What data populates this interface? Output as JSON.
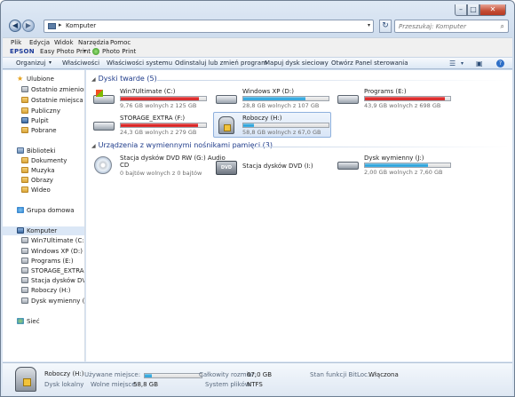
{
  "titlebar": {
    "address_text": "Komputer",
    "search_placeholder": "Przeszukaj: Komputer"
  },
  "menu": [
    "Plik",
    "Edycja",
    "Widok",
    "Narzędzia",
    "Pomoc"
  ],
  "epson_bar": {
    "logo": "EPSON",
    "easy_photo_print": "Easy Photo Print",
    "photo_print": "Photo Print"
  },
  "toolbar": {
    "organize": "Organizuj",
    "properties": "Właściwości",
    "system_properties": "Właściwości systemu",
    "uninstall": "Odinstaluj lub zmień program",
    "map_drive": "Mapuj dysk sieciowy",
    "control_panel": "Otwórz Panel sterowania"
  },
  "sidebar": {
    "favorites": "Ulubione",
    "favorites_items": [
      "Ostatnio zmienione",
      "Ostatnie miejsca",
      "Publiczny",
      "Pulpit",
      "Pobrane"
    ],
    "libraries": "Biblioteki",
    "libraries_items": [
      "Dokumenty",
      "Muzyka",
      "Obrazy",
      "Wideo"
    ],
    "homegroup": "Grupa domowa",
    "computer": "Komputer",
    "computer_items": [
      "Win7Ultimate (C:)",
      "Windows XP (D:)",
      "Programs (E:)",
      "STORAGE_EXTRA (F:)",
      "Stacja dysków DVD RW (G:)",
      "Roboczy (H:)",
      "Dysk wymienny (J:)"
    ],
    "network": "Sieć"
  },
  "sections": {
    "hard_drives": "Dyski twarde (5)",
    "removable": "Urządzenia z wymiennymi nośnikami pamięci (3)"
  },
  "hard_drives": [
    {
      "name": "Win7Ultimate (C:)",
      "free_text": "9,76 GB wolnych z 125 GB",
      "used_fraction": 0.92,
      "color": "#d71919"
    },
    {
      "name": "Windows XP (D:)",
      "free_text": "28,8 GB wolnych z 107 GB",
      "used_fraction": 0.73,
      "color": "#26a0da"
    },
    {
      "name": "Programs (E:)",
      "free_text": "43,9 GB wolnych z 698 GB",
      "used_fraction": 0.94,
      "color": "#d71919"
    },
    {
      "name": "STORAGE_EXTRA (F:)",
      "free_text": "24,3 GB wolnych z 279 GB",
      "used_fraction": 0.91,
      "color": "#d71919"
    },
    {
      "name": "Roboczy (H:)",
      "free_text": "58,8 GB wolnych z 67,0 GB",
      "used_fraction": 0.12,
      "color": "#26a0da"
    }
  ],
  "removable_devices": [
    {
      "name_line1": "Stacja dysków DVD RW (G:) Audio",
      "name_line2": "CD",
      "free_text": "0 bajtów wolnych z 0 bajtów"
    },
    {
      "name": "Stacja dysków DVD (I:)",
      "dvd_label": "DVD"
    },
    {
      "name": "Dysk wymienny (J:)",
      "free_text": "2,00 GB wolnych z 7,60 GB",
      "used_fraction": 0.74
    }
  ],
  "details": {
    "name": "Roboczy (H:)",
    "type": "Dysk lokalny",
    "used_label": "Używane miejsce:",
    "used_fraction": 0.12,
    "free_label": "Wolne miejsce:",
    "free_value": "58,8 GB",
    "total_label": "Całkowity rozmiar:",
    "total_value": "67,0 GB",
    "fs_label": "System plików:",
    "fs_value": "NTFS",
    "bitlocker_label": "Stan funkcji BitLoc...",
    "bitlocker_value": "Włączona"
  }
}
